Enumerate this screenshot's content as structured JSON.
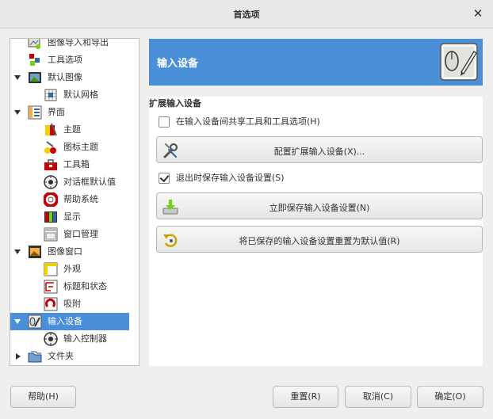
{
  "window": {
    "title": "首选项",
    "close_glyph": "✕"
  },
  "tree": {
    "items": [
      {
        "label": "图像导入和导出",
        "icon": "image-import-export-icon",
        "level": 1,
        "expander": ""
      },
      {
        "label": "工具选项",
        "icon": "tool-options-icon",
        "level": 1,
        "expander": ""
      },
      {
        "label": "默认图像",
        "icon": "default-image-icon",
        "level": 1,
        "expander": "open"
      },
      {
        "label": "默认网格",
        "icon": "default-grid-icon",
        "level": 2,
        "expander": ""
      },
      {
        "label": "界面",
        "icon": "interface-icon",
        "level": 1,
        "expander": "open"
      },
      {
        "label": "主题",
        "icon": "theme-icon",
        "level": 2,
        "expander": ""
      },
      {
        "label": "图标主题",
        "icon": "icon-theme-icon",
        "level": 2,
        "expander": ""
      },
      {
        "label": "工具箱",
        "icon": "toolbox-icon",
        "level": 2,
        "expander": ""
      },
      {
        "label": "对话框默认值",
        "icon": "dialog-defaults-icon",
        "level": 2,
        "expander": ""
      },
      {
        "label": "帮助系统",
        "icon": "help-system-icon",
        "level": 2,
        "expander": ""
      },
      {
        "label": "显示",
        "icon": "display-icon",
        "level": 2,
        "expander": ""
      },
      {
        "label": "窗口管理",
        "icon": "window-management-icon",
        "level": 2,
        "expander": ""
      },
      {
        "label": "图像窗口",
        "icon": "image-window-icon",
        "level": 1,
        "expander": "open"
      },
      {
        "label": "外观",
        "icon": "appearance-icon",
        "level": 2,
        "expander": ""
      },
      {
        "label": "标题和状态",
        "icon": "title-status-icon",
        "level": 2,
        "expander": ""
      },
      {
        "label": "吸附",
        "icon": "snapping-icon",
        "level": 2,
        "expander": ""
      },
      {
        "label": "输入设备",
        "icon": "input-devices-icon",
        "level": 1,
        "expander": "open",
        "selected": true
      },
      {
        "label": "输入控制器",
        "icon": "input-controllers-icon",
        "level": 2,
        "expander": ""
      },
      {
        "label": "文件夹",
        "icon": "folders-icon",
        "level": 1,
        "expander": "closed"
      }
    ]
  },
  "panel": {
    "title": "输入设备",
    "icon": "input-devices-large-icon",
    "section_title": "扩展输入设备",
    "share_checkbox": {
      "label": "在输入设备间共享工具和工具选项(H)",
      "checked": false
    },
    "configure_button": {
      "label": "配置扩展输入设备(X)...",
      "icon": "wrench-screwdriver-icon"
    },
    "save_on_exit_checkbox": {
      "label": "退出时保存输入设备设置(S)",
      "checked": true
    },
    "save_now_button": {
      "label": "立即保存输入设备设置(N)",
      "icon": "save-download-icon"
    },
    "reset_button": {
      "label": "将已保存的输入设备设置重置为默认值(R)",
      "icon": "reset-arrow-icon"
    }
  },
  "footer": {
    "help": "帮助(H)",
    "reset": "重置(R)",
    "cancel": "取消(C)",
    "ok": "确定(O)"
  },
  "colors": {
    "selection": "#4a90d9",
    "window_bg": "#efefee"
  }
}
